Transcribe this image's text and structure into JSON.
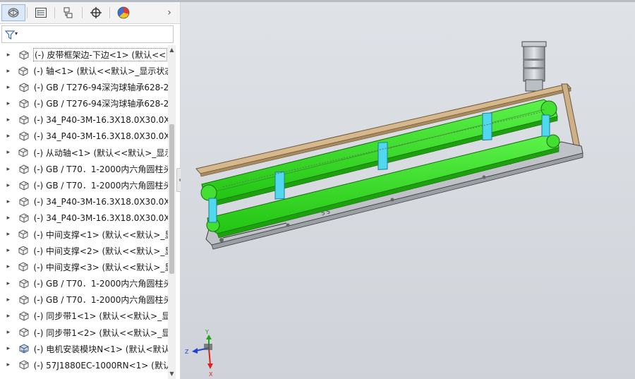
{
  "panel": {
    "tabs": [
      {
        "name": "featuremanager-tab",
        "icon": "featuremanager-icon",
        "active": true
      },
      {
        "name": "propertymanager-tab",
        "icon": "propertymanager-icon",
        "active": false
      },
      {
        "name": "configurationmanager-tab",
        "icon": "configurationmanager-icon",
        "active": false
      },
      {
        "name": "dimxpertmanager-tab",
        "icon": "dimxpertmanager-icon",
        "active": false
      },
      {
        "name": "displaymanager-tab",
        "icon": "displaymanager-icon",
        "active": false
      }
    ],
    "scroll_right_glyph": "›",
    "filter_caret": "▾"
  },
  "tree": {
    "items": [
      {
        "label": "(-) 皮带框架边-下边<1> (默认<<"
      },
      {
        "label": "(-) 轴<1> (默认<<默认>_显示状态"
      },
      {
        "label": "(-) GB / T276-94深沟球轴承628-2"
      },
      {
        "label": "(-) GB / T276-94深沟球轴承628-2"
      },
      {
        "label": "(-) 34_P40-3M-16.3X18.0X30.0X"
      },
      {
        "label": "(-) 34_P40-3M-16.3X18.0X30.0X"
      },
      {
        "label": "(-) 从动轴<1> (默认<<默认>_显示"
      },
      {
        "label": "(-) GB / T70．1-2000内六角圆柱头"
      },
      {
        "label": "(-) GB / T70．1-2000内六角圆柱头"
      },
      {
        "label": "(-) 34_P40-3M-16.3X18.0X30.0X"
      },
      {
        "label": "(-) 34_P40-3M-16.3X18.0X30.0X"
      },
      {
        "label": "(-) 中间支撑<1> (默认<<默认>_显"
      },
      {
        "label": "(-) 中间支撑<2> (默认<<默认>_显"
      },
      {
        "label": "(-) 中间支撑<3> (默认<<默认>_显"
      },
      {
        "label": "(-) GB / T70．1-2000内六角圆柱头"
      },
      {
        "label": "(-) GB / T70．1-2000内六角圆柱头"
      },
      {
        "label": "(-) 同步带1<1> (默认<<默认>_显"
      },
      {
        "label": "(-) 同步带1<2> (默认<<默认>_显"
      },
      {
        "label": "(-) 电机安装模块N<1> (默认<默认"
      },
      {
        "label": "(-) 57J1880EC-1000RN<1> (默认"
      }
    ],
    "expander_glyph": "▸"
  },
  "scrollbar": {
    "up_glyph": "▲",
    "down_glyph": "▼"
  },
  "triad": {
    "x_label": "X",
    "y_label": "Y",
    "z_label": "Z"
  },
  "colors": {
    "belt_green": "#33dd22",
    "support_cyan": "#4fd8ee",
    "frame_tan": "#c4a57c",
    "viewport_bg": "#d5d8de",
    "triad_x": "#e0201a",
    "triad_y": "#18a818",
    "triad_z": "#2040e0"
  }
}
